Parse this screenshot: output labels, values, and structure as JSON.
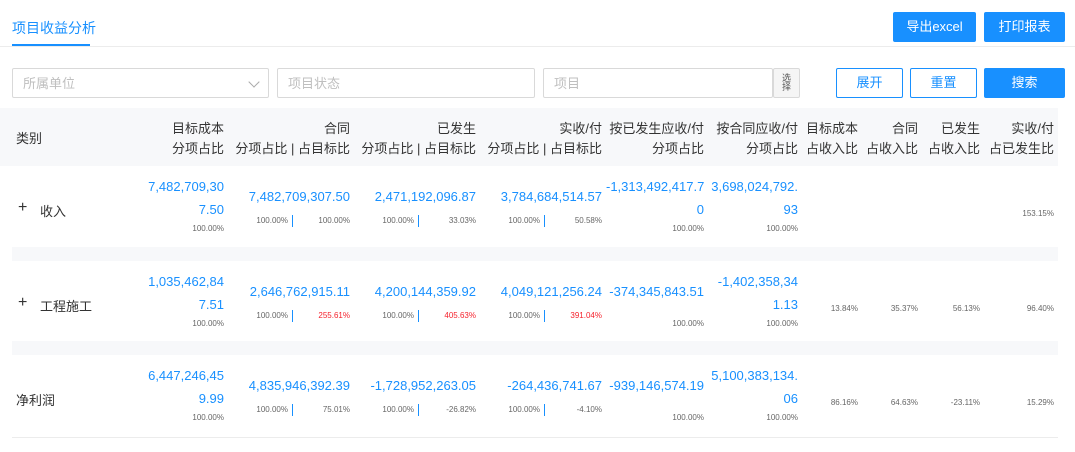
{
  "tab": {
    "label": "项目收益分析"
  },
  "toolbar": {
    "export_label": "导出excel",
    "print_label": "打印报表"
  },
  "filters": {
    "unit_placeholder": "所属单位",
    "status_placeholder": "项目状态",
    "project_placeholder": "项目",
    "picker_label": "选\n择",
    "expand_label": "展开",
    "reset_label": "重置",
    "search_label": "搜索"
  },
  "columns": {
    "category": "类别",
    "target_cost": [
      "目标成本",
      "分项占比"
    ],
    "contract": [
      "合同",
      "分项占比 | 占目标比"
    ],
    "occurred": [
      "已发生",
      "分项占比 | 占目标比"
    ],
    "paid": [
      "实收/付",
      "分项占比 | 占目标比"
    ],
    "by_occurred": [
      "按已发生应收/付",
      "分项占比"
    ],
    "by_contract": [
      "按合同应收/付",
      "分项占比"
    ],
    "target_income": [
      "目标成本",
      "占收入比"
    ],
    "contract_income": [
      "合同",
      "占收入比"
    ],
    "occurred_income": [
      "已发生",
      "占收入比"
    ],
    "paid_occurred": [
      "实收/付",
      "占已发生比"
    ]
  },
  "rows": [
    {
      "expand": "+",
      "category": "收入",
      "target_cost": [
        "7,482,709,30",
        "7.50"
      ],
      "target_pct": "100.00%",
      "contract": "7,482,709,307.50",
      "contract_pct": "100.00%",
      "contract_target": "100.00%",
      "contract_red": false,
      "occurred": "2,471,192,096.87",
      "occurred_pct": "100.00%",
      "occurred_target": "33.03%",
      "occurred_red": false,
      "paid": "3,784,684,514.57",
      "paid_pct": "100.00%",
      "paid_target": "50.58%",
      "paid_red": false,
      "by_occurred": [
        "-1,313,492,417.7",
        "0"
      ],
      "by_occurred_pct": "100.00%",
      "by_contract": [
        "3,698,024,792.",
        "93"
      ],
      "by_contract_pct": "100.00%",
      "target_income": "",
      "contract_income": "",
      "occurred_income": "",
      "paid_occurred": "153.15%"
    },
    {
      "expand": "+",
      "category": "工程施工",
      "target_cost": [
        "1,035,462,84",
        "7.51"
      ],
      "target_pct": "100.00%",
      "contract": "2,646,762,915.11",
      "contract_pct": "100.00%",
      "contract_target": "255.61%",
      "contract_red": true,
      "occurred": "4,200,144,359.92",
      "occurred_pct": "100.00%",
      "occurred_target": "405.63%",
      "occurred_red": true,
      "paid": "4,049,121,256.24",
      "paid_pct": "100.00%",
      "paid_target": "391.04%",
      "paid_red": true,
      "by_occurred": [
        "-374,345,843.51",
        ""
      ],
      "by_occurred_pct": "100.00%",
      "by_contract": [
        "-1,402,358,34",
        "1.13"
      ],
      "by_contract_pct": "100.00%",
      "target_income": "13.84%",
      "contract_income": "35.37%",
      "occurred_income": "56.13%",
      "paid_occurred": "96.40%"
    },
    {
      "expand": "",
      "category": "净利润",
      "target_cost": [
        "6,447,246,45",
        "9.99"
      ],
      "target_pct": "100.00%",
      "contract": "4,835,946,392.39",
      "contract_pct": "100.00%",
      "contract_target": "75.01%",
      "contract_red": false,
      "occurred": "-1,728,952,263.05",
      "occurred_pct": "100.00%",
      "occurred_target": "-26.82%",
      "occurred_red": false,
      "paid": "-264,436,741.67",
      "paid_pct": "100.00%",
      "paid_target": "-4.10%",
      "paid_red": false,
      "by_occurred": [
        "-939,146,574.19",
        ""
      ],
      "by_occurred_pct": "100.00%",
      "by_contract": [
        "5,100,383,134.",
        "06"
      ],
      "by_contract_pct": "100.00%",
      "target_income": "86.16%",
      "contract_income": "64.63%",
      "occurred_income": "-23.11%",
      "paid_occurred": "15.29%"
    }
  ],
  "colors": {
    "accent": "#1890ff",
    "negative": "#f5222d"
  }
}
